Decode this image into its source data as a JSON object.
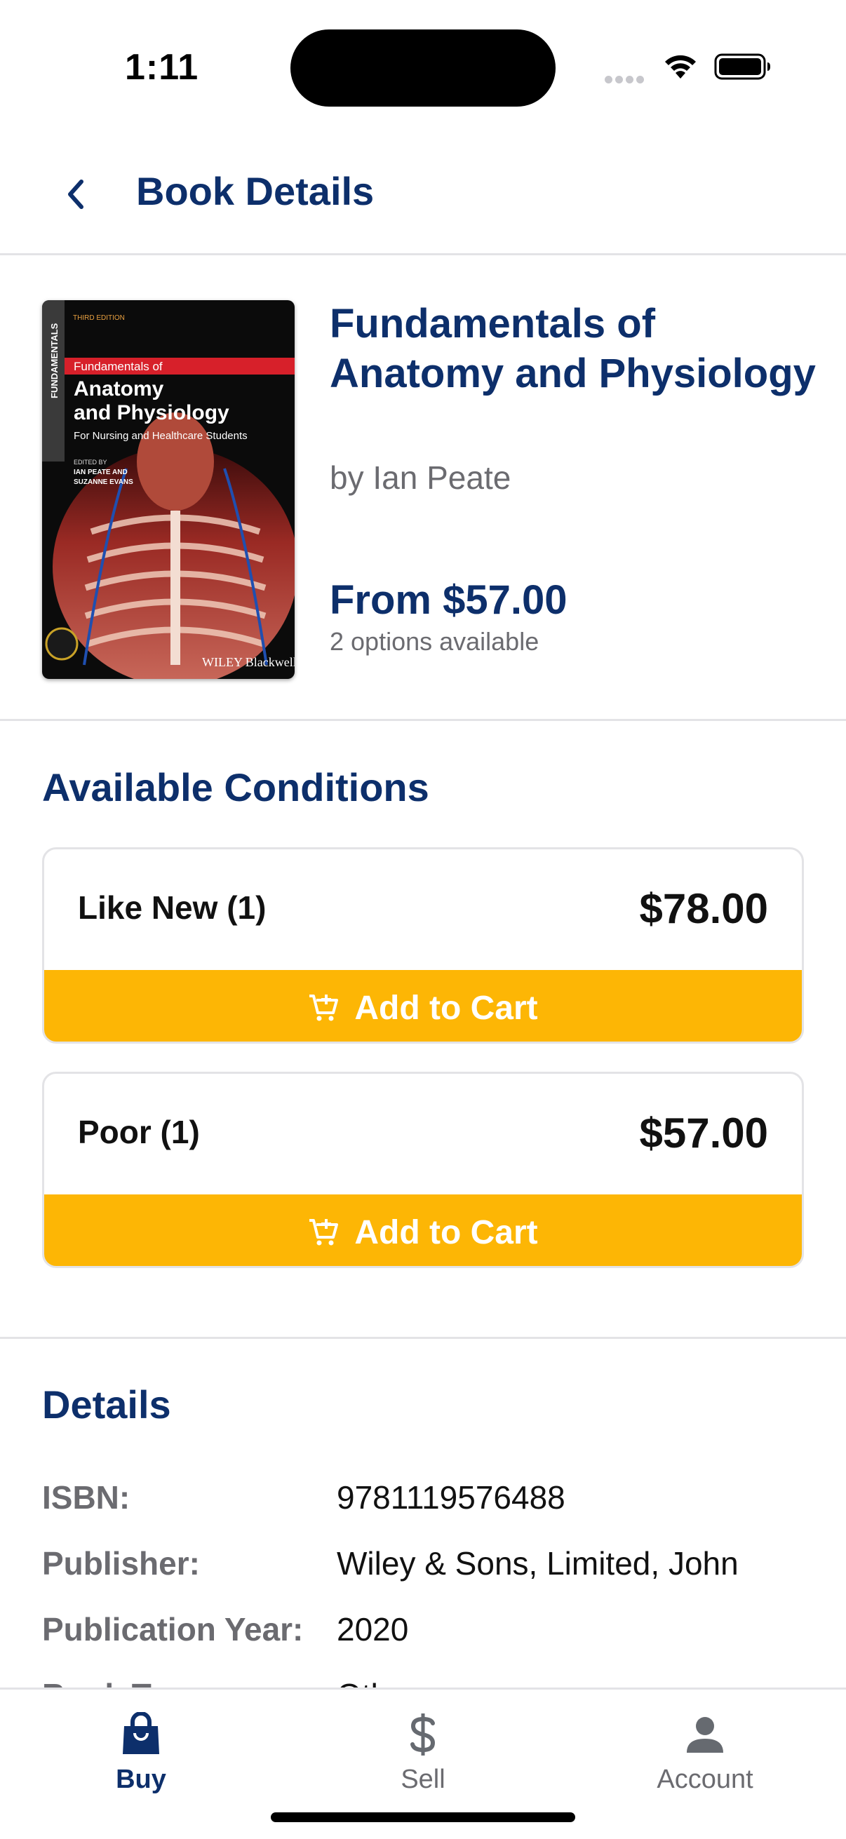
{
  "status_bar": {
    "time": "1:11"
  },
  "header": {
    "back_icon": "chevron-left-icon",
    "title": "Book Details"
  },
  "book": {
    "title": "Fundamentals of Anatomy and Physiology",
    "author": "by Ian Peate",
    "price_from": "From $57.00",
    "options_count": "2 options available",
    "cover": {
      "edition": "THIRD EDITION",
      "spine": "FUNDAMENTALS",
      "subtitle_small": "Fundamentals of",
      "title_line1": "Anatomy",
      "title_line2": "and Physiology",
      "tagline": "For Nursing and Healthcare Students",
      "edited_by": "EDITED BY",
      "editor1": "IAN PEATE AND",
      "editor2": "SUZANNE EVANS",
      "publisher": "WILEY Blackwell"
    }
  },
  "conditions": {
    "title": "Available Conditions",
    "items": [
      {
        "label": "Like New (1)",
        "price": "$78.00",
        "button": "Add to Cart"
      },
      {
        "label": "Poor (1)",
        "price": "$57.00",
        "button": "Add to Cart"
      }
    ]
  },
  "details": {
    "title": "Details",
    "rows": [
      {
        "key": "ISBN:",
        "value": "9781119576488"
      },
      {
        "key": "Publisher:",
        "value": "Wiley & Sons, Limited, John"
      },
      {
        "key": "Publication Year:",
        "value": "2020"
      },
      {
        "key": "Book Type:",
        "value": "Other"
      }
    ]
  },
  "tab_bar": {
    "tabs": [
      {
        "label": "Buy",
        "icon": "shopping-bag-icon",
        "active": true
      },
      {
        "label": "Sell",
        "icon": "dollar-icon",
        "active": false
      },
      {
        "label": "Account",
        "icon": "person-icon",
        "active": false
      }
    ]
  },
  "colors": {
    "brand_navy": "#0d2f6b",
    "accent_yellow": "#fdb605",
    "muted_gray": "#6b6b70",
    "divider": "#e3e3e6"
  }
}
